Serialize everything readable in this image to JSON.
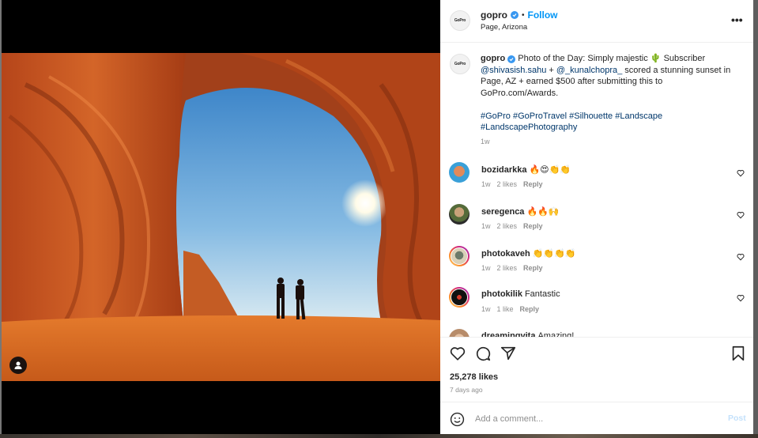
{
  "post": {
    "author": "gopro",
    "avatar_label": "GoPro",
    "follow_label": "Follow",
    "separator": "•",
    "location": "Page, Arizona",
    "more_label": "•••",
    "caption": {
      "username": "gopro",
      "text_1": "Photo of the Day: Simply majestic",
      "emoji": "🌵",
      "text_2": "Subscriber",
      "mention_1": "@shivasish.sahu",
      "plus": "+",
      "mention_2": "@_kunalchopra_",
      "text_3": "scored a stunning sunset in Page, AZ + earned $500 after submitting this to GoPro.com/Awards.",
      "hashtags": [
        "#GoPro",
        "#GoProTravel",
        "#Silhouette",
        "#Landscape",
        "#LandscapePhotography"
      ],
      "time": "1w"
    },
    "comments": [
      {
        "username": "bozidarkka",
        "text": "🔥😍👏👏",
        "time": "1w",
        "likes": "2 likes",
        "reply": "Reply"
      },
      {
        "username": "seregenca",
        "text": "🔥🔥🙌",
        "time": "1w",
        "likes": "2 likes",
        "reply": "Reply"
      },
      {
        "username": "photokaveh",
        "text": "👏👏👏👏",
        "time": "1w",
        "likes": "2 likes",
        "reply": "Reply"
      },
      {
        "username": "photokilik",
        "text": "Fantastic",
        "time": "1w",
        "likes": "1 like",
        "reply": "Reply"
      },
      {
        "username": "dreamingvita",
        "text": "Amazing!",
        "time": "",
        "likes": "",
        "reply": ""
      }
    ],
    "likes_count": "25,278 likes",
    "posted_ago": "7 days ago",
    "add_comment_placeholder": "Add a comment...",
    "post_label": "Post"
  },
  "colors": {
    "link_blue": "#0095f6",
    "mention_blue": "#00376b",
    "post_disabled": "#c4e1fb",
    "muted": "#8e8e8e",
    "text": "#262626"
  }
}
